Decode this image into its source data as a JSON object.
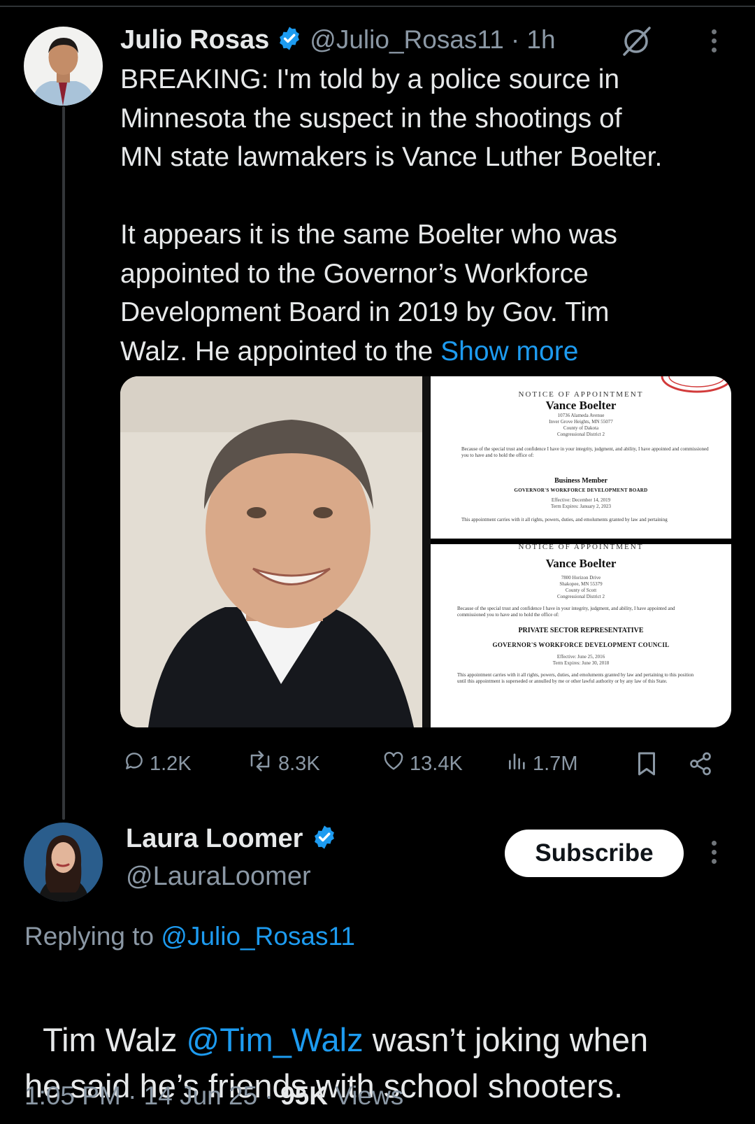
{
  "tweet": {
    "author_name": "Julio Rosas",
    "author_handle": "@Julio_Rosas11",
    "time": "· 1h",
    "body": "BREAKING: I'm told by a police source in\nMinnesota the suspect in the shootings of\nMN state lawmakers is Vance Luther Boelter.\n\nIt appears it is the same Boelter who was\nappointed to the Governor’s Workforce\nDevelopment Board in 2019 by Gov. Tim\nWalz. He appointed to the ",
    "show_more": "Show more",
    "doc1": {
      "heading": "NOTICE OF APPOINTMENT",
      "name": "Vance Boelter",
      "addr1": "10736 Alameda Avenue",
      "addr2": "Inver Grove Heights, MN 55077",
      "addr3": "County of Dakota",
      "addr4": "Congressional District 2",
      "para": "Because of the special trust and confidence I have in your integrity, judgment, and ability, I have appointed and commissioned you to have and to hold the office of:",
      "role": "Business Member",
      "board": "GOVERNOR'S WORKFORCE DEVELOPMENT BOARD",
      "effective": "Effective: December 14, 2019",
      "expires": "Term Expires: January 2, 2023",
      "footer": "This appointment carries with it all rights, powers, duties, and emoluments granted by law and pertaining"
    },
    "doc2": {
      "heading": "NOTICE OF APPOINTMENT",
      "name": "Vance Boelter",
      "addr1": "7800 Horizon Drive",
      "addr2": "Shakopee, MN 55379",
      "addr3": "County of Scott",
      "addr4": "Congressional District 2",
      "para": "Because of the special trust and confidence I have in your integrity, judgment, and ability, I have appointed and commissioned you to have and to hold the office of:",
      "role": "PRIVATE SECTOR REPRESENTATIVE",
      "board": "GOVERNOR'S WORKFORCE DEVELOPMENT COUNCIL",
      "effective": "Effective: June 25, 2016",
      "expires": "Term Expires: June 30, 2018",
      "footer": "This appointment carries with it all rights, powers, duties, and emoluments granted by law and pertaining to this position until this appointment is superseded or annulled by me or other lawful authority or by any law of this State."
    },
    "stats": {
      "replies": "1.2K",
      "reposts": "8.3K",
      "likes": "13.4K",
      "views": "1.7M"
    }
  },
  "reply": {
    "author_name": "Laura Loomer",
    "author_handle": "@LauraLoomer",
    "subscribe_label": "Subscribe",
    "replying_prefix": "Replying to ",
    "replying_handle": "@Julio_Rosas11",
    "text_start": "Tim Walz ",
    "mention": "@Tim_Walz",
    "text_end": " wasn’t joking when\nhe said he’s friends with school shooters.",
    "time": "1:05 PM · 14 Jun 25 · ",
    "views_count": "95K",
    "views_label": " Views"
  },
  "colors": {
    "accent": "#1d9bf0",
    "text": "#e7e9ea",
    "muted": "#8b98a5",
    "background": "#000000"
  },
  "icons": [
    "verified-badge-icon",
    "grok-slash-icon",
    "more-icon",
    "reply-icon",
    "repost-icon",
    "like-icon",
    "views-icon",
    "bookmark-icon",
    "share-icon"
  ]
}
